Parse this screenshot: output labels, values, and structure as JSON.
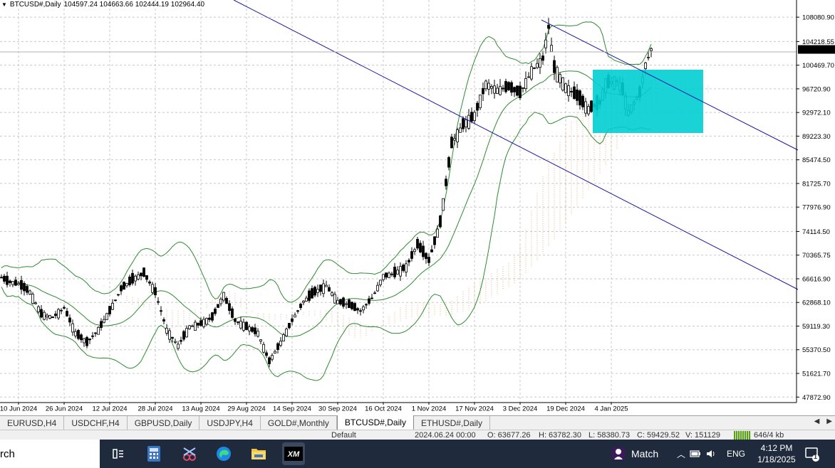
{
  "header": {
    "symbol": "BTCUSD#,Daily",
    "ohlc": "104597.24 104663.66 102444.19 102964.40"
  },
  "chart_data": {
    "type": "candlestick",
    "title": "BTCUSD#,Daily",
    "ylim": [
      47000,
      110800
    ],
    "y_ticks": [
      "108080.90",
      "104218.55",
      "100469.70",
      "96720.90",
      "92972.10",
      "89223.30",
      "85474.50",
      "81725.70",
      "77976.90",
      "74114.50",
      "70365.75",
      "66616.90",
      "62868.10",
      "59119.30",
      "55370.50",
      "51621.70",
      "47872.90"
    ],
    "y_tick_values": [
      108080.9,
      104218.55,
      100469.7,
      96720.9,
      92972.1,
      89223.3,
      85474.5,
      81725.7,
      77976.9,
      74114.5,
      70365.75,
      66616.9,
      62868.1,
      59119.3,
      55370.5,
      51621.7,
      47872.9
    ],
    "x_ticks": [
      "10 Jun 2024",
      "26 Jun 2024",
      "12 Jul 2024",
      "28 Jul 2024",
      "13 Aug 2024",
      "29 Aug 2024",
      "14 Sep 2024",
      "30 Sep 2024",
      "16 Oct 2024",
      "1 Nov 2024",
      "17 Nov 2024",
      "3 Dec 2024",
      "19 Dec 2024",
      "4 Jan 2025"
    ],
    "x_tick_days": [
      0,
      16,
      32,
      48,
      64,
      80,
      96,
      112,
      128,
      144,
      160,
      176,
      192,
      208
    ],
    "current_price": "102964.40",
    "current_price_value": 102964.4,
    "grid": true,
    "close_series": [
      {
        "d": -8,
        "c": 67500
      },
      {
        "d": -4,
        "c": 66200
      },
      {
        "d": 0,
        "c": 65800
      },
      {
        "d": 4,
        "c": 64500
      },
      {
        "d": 8,
        "c": 61000
      },
      {
        "d": 12,
        "c": 60500
      },
      {
        "d": 16,
        "c": 62000
      },
      {
        "d": 20,
        "c": 58000
      },
      {
        "d": 24,
        "c": 56500
      },
      {
        "d": 28,
        "c": 58500
      },
      {
        "d": 32,
        "c": 61500
      },
      {
        "d": 36,
        "c": 65000
      },
      {
        "d": 40,
        "c": 66500
      },
      {
        "d": 44,
        "c": 67500
      },
      {
        "d": 48,
        "c": 64500
      },
      {
        "d": 52,
        "c": 58500
      },
      {
        "d": 56,
        "c": 56000
      },
      {
        "d": 60,
        "c": 59000
      },
      {
        "d": 64,
        "c": 59500
      },
      {
        "d": 68,
        "c": 60500
      },
      {
        "d": 72,
        "c": 64000
      },
      {
        "d": 76,
        "c": 60000
      },
      {
        "d": 80,
        "c": 59000
      },
      {
        "d": 84,
        "c": 58000
      },
      {
        "d": 88,
        "c": 53500
      },
      {
        "d": 92,
        "c": 56500
      },
      {
        "d": 96,
        "c": 60000
      },
      {
        "d": 100,
        "c": 63000
      },
      {
        "d": 104,
        "c": 64500
      },
      {
        "d": 108,
        "c": 65500
      },
      {
        "d": 112,
        "c": 63000
      },
      {
        "d": 116,
        "c": 62500
      },
      {
        "d": 120,
        "c": 61500
      },
      {
        "d": 124,
        "c": 63500
      },
      {
        "d": 128,
        "c": 67000
      },
      {
        "d": 132,
        "c": 67500
      },
      {
        "d": 136,
        "c": 68500
      },
      {
        "d": 140,
        "c": 72000
      },
      {
        "d": 144,
        "c": 69500
      },
      {
        "d": 148,
        "c": 75500
      },
      {
        "d": 152,
        "c": 88000
      },
      {
        "d": 156,
        "c": 91000
      },
      {
        "d": 160,
        "c": 92500
      },
      {
        "d": 164,
        "c": 97500
      },
      {
        "d": 168,
        "c": 96500
      },
      {
        "d": 172,
        "c": 97000
      },
      {
        "d": 176,
        "c": 96000
      },
      {
        "d": 180,
        "c": 99500
      },
      {
        "d": 184,
        "c": 101500
      },
      {
        "d": 186,
        "c": 106500
      },
      {
        "d": 188,
        "c": 100000
      },
      {
        "d": 192,
        "c": 97000
      },
      {
        "d": 196,
        "c": 95500
      },
      {
        "d": 200,
        "c": 93500
      },
      {
        "d": 204,
        "c": 94500
      },
      {
        "d": 206,
        "c": 97500
      },
      {
        "d": 210,
        "c": 98000
      },
      {
        "d": 212,
        "c": 96500
      },
      {
        "d": 214,
        "c": 93000
      },
      {
        "d": 216,
        "c": 94500
      },
      {
        "d": 218,
        "c": 96000
      },
      {
        "d": 220,
        "c": 100500
      },
      {
        "d": 222,
        "c": 102964
      }
    ]
  },
  "tabs": [
    {
      "label": "EURUSD,H4",
      "active": false
    },
    {
      "label": "USDCHF,H4",
      "active": false
    },
    {
      "label": "GBPUSD,Daily",
      "active": false
    },
    {
      "label": "USDJPY,H4",
      "active": false
    },
    {
      "label": "GOLD#,Monthly",
      "active": false
    },
    {
      "label": "BTCUSD#,Daily",
      "active": true
    },
    {
      "label": "ETHUSD#,Daily",
      "active": false
    }
  ],
  "data_window": {
    "profile": "Default",
    "date": "2024.06.24 00:00",
    "open": "O: 63677.26",
    "high": "H: 63782.30",
    "low": "L: 58380.73",
    "close": "C: 59429.52",
    "volume": "V: 151129",
    "traffic": "646/4 kb"
  },
  "taskbar": {
    "search_text": "rch",
    "match_label": "Match",
    "language": "ENG",
    "time": "4:12 PM",
    "date": "1/18/2025",
    "notification_count": "1",
    "colors": {
      "background": "#1f2b3c",
      "xm_brand": "#000000",
      "edge": "#1e88e5"
    }
  }
}
